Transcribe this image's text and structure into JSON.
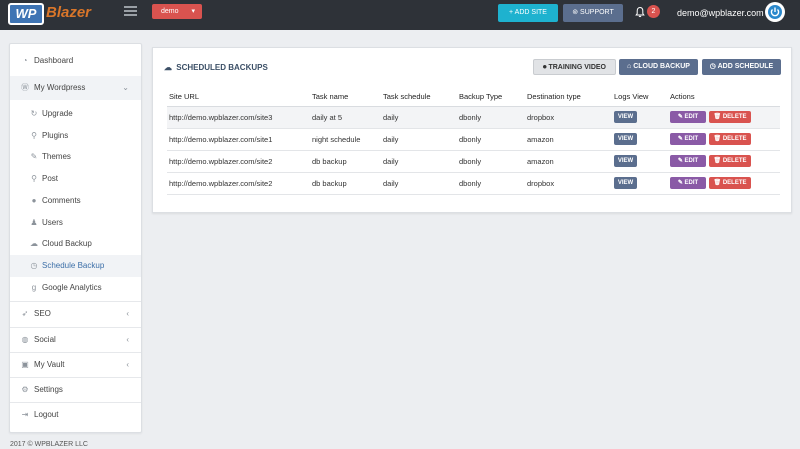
{
  "header": {
    "logo_wp": "WP",
    "logo_text": "Blazer",
    "site_selector": "demo",
    "add_site_label": "+ ADD SITE",
    "support_label": "SUPPORT",
    "notification_count": "2",
    "user_email": "demo@wpblazer.com"
  },
  "sidebar": {
    "items": [
      {
        "label": "Dashboard",
        "icon": "dashboard-icon"
      },
      {
        "label": "My Wordpress",
        "icon": "wordpress-icon"
      },
      {
        "label": "Upgrade",
        "icon": "refresh-icon"
      },
      {
        "label": "Plugins",
        "icon": "plug-icon"
      },
      {
        "label": "Themes",
        "icon": "brush-icon"
      },
      {
        "label": "Post",
        "icon": "pin-icon"
      },
      {
        "label": "Comments",
        "icon": "comments-icon"
      },
      {
        "label": "Users",
        "icon": "user-icon"
      },
      {
        "label": "Cloud Backup",
        "icon": "cloud-icon"
      },
      {
        "label": "Schedule Backup",
        "icon": "clock-icon"
      },
      {
        "label": "Google Analytics",
        "icon": "google-icon"
      },
      {
        "label": "SEO",
        "icon": "rocket-icon"
      },
      {
        "label": "Social",
        "icon": "globe-icon"
      },
      {
        "label": "My Vault",
        "icon": "image-icon"
      },
      {
        "label": "Settings",
        "icon": "gear-icon"
      },
      {
        "label": "Logout",
        "icon": "logout-icon"
      }
    ]
  },
  "footer": {
    "copyright": "2017 © WPBLAZER LLC"
  },
  "main": {
    "title": "SCHEDULED BACKUPS",
    "training_video_label": "TRAINING VIDEO",
    "cloud_backup_label": "CLOUD BACKUP",
    "add_schedule_label": "ADD SCHEDULE",
    "columns": [
      "Site URL",
      "Task name",
      "Task schedule",
      "Backup Type",
      "Destination type",
      "Logs View",
      "Actions"
    ],
    "rows": [
      {
        "site": "http://demo.wpblazer.com/site3",
        "task": "daily at 5",
        "schedule": "daily",
        "type": "dbonly",
        "dest": "dropbox"
      },
      {
        "site": "http://demo.wpblazer.com/site1",
        "task": "night schedule",
        "schedule": "daily",
        "type": "dbonly",
        "dest": "amazon"
      },
      {
        "site": "http://demo.wpblazer.com/site2",
        "task": "db backup",
        "schedule": "daily",
        "type": "dbonly",
        "dest": "amazon"
      },
      {
        "site": "http://demo.wpblazer.com/site2",
        "task": "db backup",
        "schedule": "daily",
        "type": "dbonly",
        "dest": "dropbox"
      }
    ],
    "view_label": "VIEW",
    "edit_label": "EDIT",
    "delete_label": "DELETE"
  },
  "colors": {
    "topbar": "#2e3238",
    "accent_cyan": "#1eb2cf",
    "slate_button": "#5b6e8e",
    "edit_purple": "#8a5aa6",
    "delete_red": "#d9534f"
  }
}
